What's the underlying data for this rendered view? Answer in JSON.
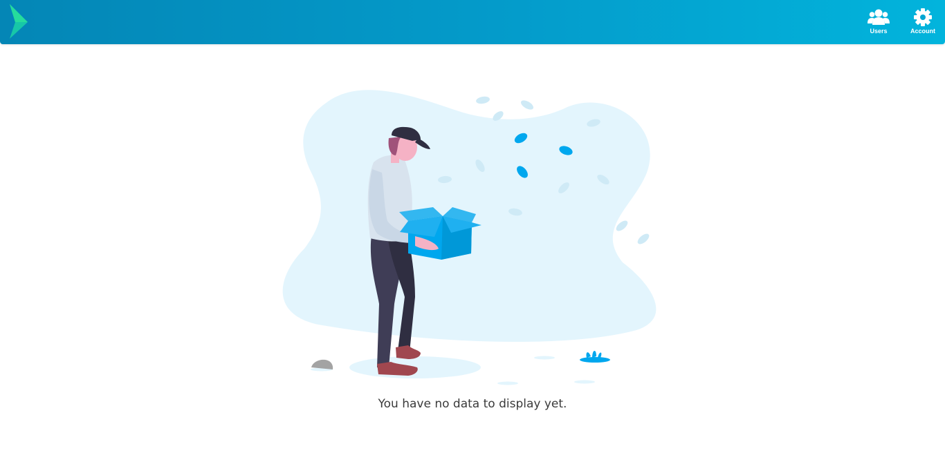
{
  "header": {
    "nav": [
      {
        "label": "Users",
        "icon": "users-icon"
      },
      {
        "label": "Account",
        "icon": "gear-icon"
      }
    ],
    "colors": {
      "gradient_start": "#0486b6",
      "gradient_end": "#02b4dc",
      "logo_green": "#1ed3a0",
      "logo_teal": "#14b6d8"
    }
  },
  "empty_state": {
    "message": "You have no data to display yet.",
    "illustration": "person-holding-empty-box-illustration"
  },
  "colors": {
    "accent": "#00a7ee",
    "blob": "#e3f5fd",
    "text": "#3a3a3a"
  }
}
